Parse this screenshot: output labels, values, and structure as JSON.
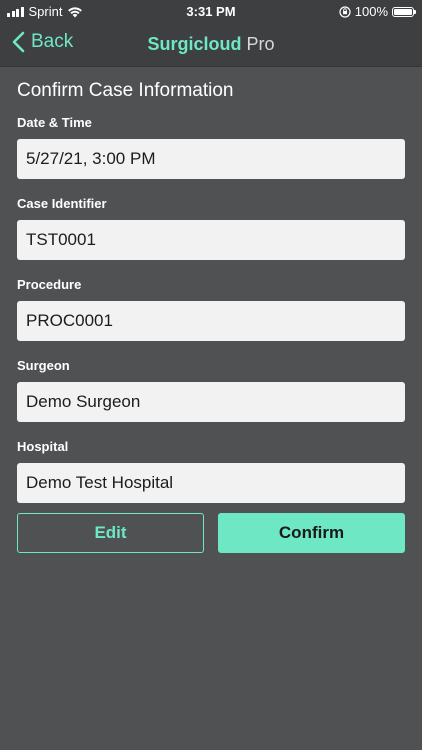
{
  "status_bar": {
    "carrier": "Sprint",
    "time": "3:31 PM",
    "battery": "100%",
    "icons": [
      "signal-icon",
      "wifi-icon",
      "orientation-lock-icon",
      "battery-icon"
    ]
  },
  "nav": {
    "back_label": "Back",
    "title_brand": "Surgicloud",
    "title_suffix": " Pro"
  },
  "form": {
    "title": "Confirm Case Information",
    "fields": [
      {
        "label": "Date & Time",
        "value": "5/27/21, 3:00 PM"
      },
      {
        "label": "Case Identifier",
        "value": "TST0001"
      },
      {
        "label": "Procedure",
        "value": "PROC0001"
      },
      {
        "label": "Surgeon",
        "value": "Demo Surgeon"
      },
      {
        "label": "Hospital",
        "value": "Demo Test Hospital"
      }
    ]
  },
  "actions": {
    "edit_label": "Edit",
    "confirm_label": "Confirm"
  },
  "colors": {
    "accent": "#6ee7c5",
    "background": "#505153",
    "bar": "#3e3f41",
    "field_bg": "#f2f2f2"
  }
}
